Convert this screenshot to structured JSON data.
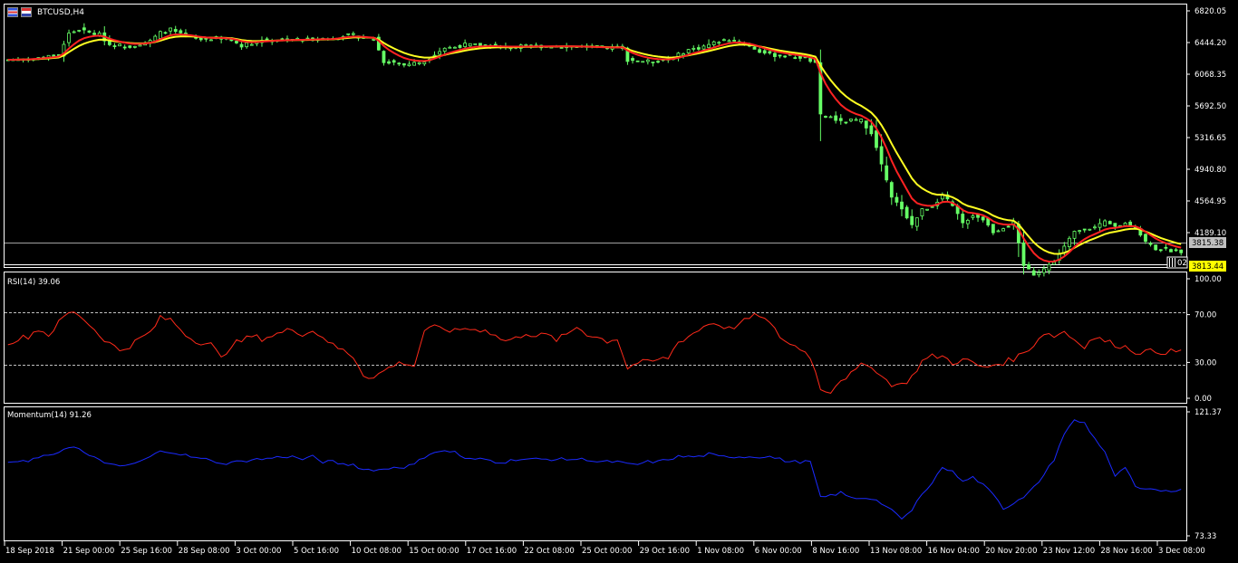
{
  "window": {
    "symbol": "BTCUSD,H4"
  },
  "colors": {
    "background": "#000000",
    "frame": "#ffffff",
    "candle": "#66ff66",
    "ma_fast": "#ff2222",
    "ma_slow": "#ffff22",
    "rsi": "#ff2a1a",
    "momentum": "#1a2aff",
    "bid_label_bg": "#c0c0c0",
    "ask_label_bg": "#ffff00"
  },
  "price_panel": {
    "ticks": [
      "6820.05",
      "6444.20",
      "6068.35",
      "5692.50",
      "5316.65",
      "4940.80",
      "4564.95",
      "4189.10",
      "3813.44"
    ],
    "bid_label": "3815.38",
    "ask_label": "3813.44",
    "button_label": "02"
  },
  "rsi_panel": {
    "label": "RSI(14) 39.06",
    "ticks": [
      "100.00",
      "70.00",
      "30.00",
      "0.00"
    ]
  },
  "momentum_panel": {
    "label": "Momentum(14) 91.26",
    "ticks": [
      "121.37",
      "73.33"
    ]
  },
  "time_axis": [
    "18 Sep 2018",
    "21 Sep 00:00",
    "25 Sep 16:00",
    "28 Sep 08:00",
    "3 Oct 00:00",
    "5 Oct 16:00",
    "10 Oct 08:00",
    "15 Oct 00:00",
    "17 Oct 16:00",
    "22 Oct 08:00",
    "25 Oct 00:00",
    "29 Oct 16:00",
    "1 Nov 08:00",
    "6 Nov 00:00",
    "8 Nov 16:00",
    "13 Nov 08:00",
    "16 Nov 04:00",
    "20 Nov 20:00",
    "23 Nov 12:00",
    "28 Nov 16:00",
    "3 Dec 08:00"
  ],
  "chart_data": [
    {
      "type": "candlestick",
      "symbol": "BTCUSD",
      "timeframe": "H4",
      "ylim": [
        3813.44,
        6820.05
      ],
      "close_path": [
        [
          0,
          6240
        ],
        [
          4,
          6250
        ],
        [
          8,
          6280
        ],
        [
          10,
          6300
        ],
        [
          12,
          6550
        ],
        [
          14,
          6600
        ],
        [
          16,
          6560
        ],
        [
          18,
          6540
        ],
        [
          20,
          6420
        ],
        [
          24,
          6400
        ],
        [
          28,
          6460
        ],
        [
          30,
          6560
        ],
        [
          32,
          6600
        ],
        [
          34,
          6540
        ],
        [
          38,
          6480
        ],
        [
          42,
          6500
        ],
        [
          44,
          6470
        ],
        [
          46,
          6410
        ],
        [
          50,
          6470
        ],
        [
          54,
          6480
        ],
        [
          58,
          6480
        ],
        [
          62,
          6490
        ],
        [
          64,
          6490
        ],
        [
          66,
          6530
        ],
        [
          68,
          6530
        ],
        [
          70,
          6500
        ],
        [
          72,
          6490
        ],
        [
          74,
          6220
        ],
        [
          76,
          6210
        ],
        [
          78,
          6180
        ],
        [
          80,
          6200
        ],
        [
          82,
          6220
        ],
        [
          84,
          6310
        ],
        [
          86,
          6380
        ],
        [
          88,
          6390
        ],
        [
          90,
          6420
        ],
        [
          94,
          6410
        ],
        [
          98,
          6390
        ],
        [
          102,
          6400
        ],
        [
          106,
          6400
        ],
        [
          110,
          6400
        ],
        [
          114,
          6390
        ],
        [
          118,
          6380
        ],
        [
          121,
          6390
        ],
        [
          122,
          6240
        ],
        [
          124,
          6230
        ],
        [
          126,
          6220
        ],
        [
          128,
          6230
        ],
        [
          130,
          6240
        ],
        [
          132,
          6300
        ],
        [
          134,
          6360
        ],
        [
          136,
          6380
        ],
        [
          138,
          6420
        ],
        [
          140,
          6460
        ],
        [
          142,
          6480
        ],
        [
          144,
          6450
        ],
        [
          146,
          6400
        ],
        [
          148,
          6340
        ],
        [
          150,
          6300
        ],
        [
          152,
          6290
        ],
        [
          154,
          6280
        ],
        [
          156,
          6270
        ],
        [
          158,
          6230
        ],
        [
          159,
          6190
        ],
        [
          160,
          5580
        ],
        [
          162,
          5560
        ],
        [
          164,
          5500
        ],
        [
          166,
          5520
        ],
        [
          168,
          5520
        ],
        [
          170,
          5380
        ],
        [
          172,
          5000
        ],
        [
          174,
          4600
        ],
        [
          176,
          4480
        ],
        [
          178,
          4280
        ],
        [
          180,
          4460
        ],
        [
          182,
          4500
        ],
        [
          184,
          4640
        ],
        [
          186,
          4500
        ],
        [
          188,
          4300
        ],
        [
          190,
          4400
        ],
        [
          192,
          4350
        ],
        [
          194,
          4200
        ],
        [
          196,
          4250
        ],
        [
          198,
          4300
        ],
        [
          200,
          3800
        ],
        [
          202,
          3700
        ],
        [
          204,
          3760
        ],
        [
          206,
          3850
        ],
        [
          208,
          4020
        ],
        [
          210,
          4200
        ],
        [
          212,
          4240
        ],
        [
          214,
          4250
        ],
        [
          216,
          4310
        ],
        [
          218,
          4260
        ],
        [
          220,
          4300
        ],
        [
          222,
          4250
        ],
        [
          224,
          4080
        ],
        [
          226,
          4000
        ],
        [
          228,
          3990
        ],
        [
          230,
          3970
        ],
        [
          231,
          3970
        ]
      ],
      "n_bars": 232
    },
    {
      "type": "line",
      "title": "RSI(14) 39.06",
      "ylim": [
        0,
        100
      ],
      "levels": [
        70,
        30
      ],
      "values": [
        [
          0,
          47
        ],
        [
          4,
          52
        ],
        [
          6,
          58
        ],
        [
          8,
          53
        ],
        [
          10,
          63
        ],
        [
          12,
          72
        ],
        [
          14,
          70
        ],
        [
          16,
          62
        ],
        [
          18,
          53
        ],
        [
          20,
          46
        ],
        [
          22,
          40
        ],
        [
          24,
          44
        ],
        [
          26,
          50
        ],
        [
          28,
          55
        ],
        [
          30,
          67
        ],
        [
          32,
          66
        ],
        [
          34,
          58
        ],
        [
          36,
          50
        ],
        [
          38,
          47
        ],
        [
          40,
          45
        ],
        [
          42,
          33
        ],
        [
          44,
          45
        ],
        [
          46,
          48
        ],
        [
          48,
          52
        ],
        [
          50,
          50
        ],
        [
          54,
          55
        ],
        [
          56,
          58
        ],
        [
          58,
          54
        ],
        [
          60,
          56
        ],
        [
          62,
          52
        ],
        [
          64,
          44
        ],
        [
          66,
          40
        ],
        [
          68,
          35
        ],
        [
          70,
          20
        ],
        [
          72,
          17
        ],
        [
          74,
          23
        ],
        [
          76,
          28
        ],
        [
          78,
          30
        ],
        [
          80,
          27
        ],
        [
          82,
          57
        ],
        [
          84,
          59
        ],
        [
          86,
          58
        ],
        [
          88,
          56
        ],
        [
          90,
          59
        ],
        [
          92,
          57
        ],
        [
          94,
          58
        ],
        [
          96,
          52
        ],
        [
          98,
          48
        ],
        [
          100,
          50
        ],
        [
          102,
          55
        ],
        [
          104,
          52
        ],
        [
          106,
          53
        ],
        [
          108,
          49
        ],
        [
          110,
          53
        ],
        [
          112,
          60
        ],
        [
          114,
          54
        ],
        [
          116,
          51
        ],
        [
          118,
          48
        ],
        [
          120,
          50
        ],
        [
          122,
          25
        ],
        [
          124,
          30
        ],
        [
          126,
          30
        ],
        [
          128,
          32
        ],
        [
          130,
          34
        ],
        [
          132,
          47
        ],
        [
          134,
          52
        ],
        [
          136,
          57
        ],
        [
          138,
          63
        ],
        [
          140,
          62
        ],
        [
          142,
          58
        ],
        [
          144,
          62
        ],
        [
          146,
          67
        ],
        [
          148,
          70
        ],
        [
          150,
          62
        ],
        [
          152,
          52
        ],
        [
          154,
          45
        ],
        [
          156,
          42
        ],
        [
          158,
          35
        ],
        [
          160,
          8
        ],
        [
          162,
          6
        ],
        [
          164,
          16
        ],
        [
          166,
          20
        ],
        [
          168,
          27
        ],
        [
          170,
          28
        ],
        [
          172,
          18
        ],
        [
          174,
          12
        ],
        [
          176,
          11
        ],
        [
          178,
          18
        ],
        [
          180,
          31
        ],
        [
          182,
          35
        ],
        [
          184,
          35
        ],
        [
          186,
          30
        ],
        [
          188,
          32
        ],
        [
          190,
          30
        ],
        [
          192,
          25
        ],
        [
          194,
          28
        ],
        [
          196,
          30
        ],
        [
          198,
          33
        ],
        [
          200,
          38
        ],
        [
          202,
          45
        ],
        [
          204,
          55
        ],
        [
          206,
          52
        ],
        [
          208,
          56
        ],
        [
          210,
          49
        ],
        [
          212,
          44
        ],
        [
          214,
          51
        ],
        [
          216,
          48
        ],
        [
          218,
          45
        ],
        [
          220,
          43
        ],
        [
          222,
          39
        ],
        [
          224,
          39
        ]
      ]
    },
    {
      "type": "line",
      "title": "Momentum(14) 91.26",
      "ylim": [
        73.33,
        121.37
      ],
      "values": [
        [
          0,
          102
        ],
        [
          4,
          102
        ],
        [
          6,
          104
        ],
        [
          8,
          104
        ],
        [
          10,
          106
        ],
        [
          12,
          108
        ],
        [
          14,
          107
        ],
        [
          16,
          104
        ],
        [
          18,
          103
        ],
        [
          20,
          101
        ],
        [
          22,
          100
        ],
        [
          24,
          101
        ],
        [
          26,
          102
        ],
        [
          28,
          104
        ],
        [
          30,
          106
        ],
        [
          32,
          106
        ],
        [
          34,
          105
        ],
        [
          36,
          104
        ],
        [
          38,
          103
        ],
        [
          40,
          103
        ],
        [
          42,
          101
        ],
        [
          44,
          102
        ],
        [
          46,
          102
        ],
        [
          48,
          103
        ],
        [
          50,
          103
        ],
        [
          54,
          104
        ],
        [
          56,
          104
        ],
        [
          58,
          103
        ],
        [
          60,
          104
        ],
        [
          62,
          102
        ],
        [
          64,
          102
        ],
        [
          66,
          101
        ],
        [
          68,
          101
        ],
        [
          70,
          99
        ],
        [
          72,
          99
        ],
        [
          74,
          99
        ],
        [
          76,
          100
        ],
        [
          78,
          100
        ],
        [
          80,
          101
        ],
        [
          82,
          104
        ],
        [
          84,
          106
        ],
        [
          86,
          106
        ],
        [
          88,
          106
        ],
        [
          90,
          103
        ],
        [
          92,
          103
        ],
        [
          94,
          103
        ],
        [
          96,
          102
        ],
        [
          98,
          102
        ],
        [
          100,
          103
        ],
        [
          102,
          103
        ],
        [
          104,
          103
        ],
        [
          106,
          103
        ],
        [
          108,
          103
        ],
        [
          110,
          103
        ],
        [
          112,
          103
        ],
        [
          114,
          103
        ],
        [
          116,
          102
        ],
        [
          118,
          102
        ],
        [
          120,
          102
        ],
        [
          122,
          101
        ],
        [
          124,
          101
        ],
        [
          126,
          102
        ],
        [
          128,
          102
        ],
        [
          130,
          103
        ],
        [
          132,
          104
        ],
        [
          134,
          104
        ],
        [
          136,
          104
        ],
        [
          138,
          105
        ],
        [
          140,
          104
        ],
        [
          142,
          104
        ],
        [
          144,
          104
        ],
        [
          146,
          104
        ],
        [
          148,
          104
        ],
        [
          150,
          104
        ],
        [
          152,
          103
        ],
        [
          154,
          102
        ],
        [
          156,
          102
        ],
        [
          158,
          102
        ],
        [
          160,
          88
        ],
        [
          162,
          89
        ],
        [
          164,
          90
        ],
        [
          166,
          88
        ],
        [
          168,
          88
        ],
        [
          170,
          88
        ],
        [
          172,
          86
        ],
        [
          174,
          83
        ],
        [
          176,
          80
        ],
        [
          178,
          83
        ],
        [
          180,
          90
        ],
        [
          182,
          94
        ],
        [
          184,
          100
        ],
        [
          186,
          98
        ],
        [
          188,
          95
        ],
        [
          190,
          96
        ],
        [
          192,
          93
        ],
        [
          194,
          90
        ],
        [
          196,
          84
        ],
        [
          198,
          86
        ],
        [
          200,
          88
        ],
        [
          202,
          92
        ],
        [
          204,
          97
        ],
        [
          206,
          103
        ],
        [
          208,
          113
        ],
        [
          210,
          118
        ],
        [
          212,
          117
        ],
        [
          214,
          111
        ],
        [
          216,
          106
        ],
        [
          218,
          96
        ],
        [
          220,
          100
        ],
        [
          222,
          92
        ],
        [
          224,
          91
        ]
      ]
    }
  ]
}
